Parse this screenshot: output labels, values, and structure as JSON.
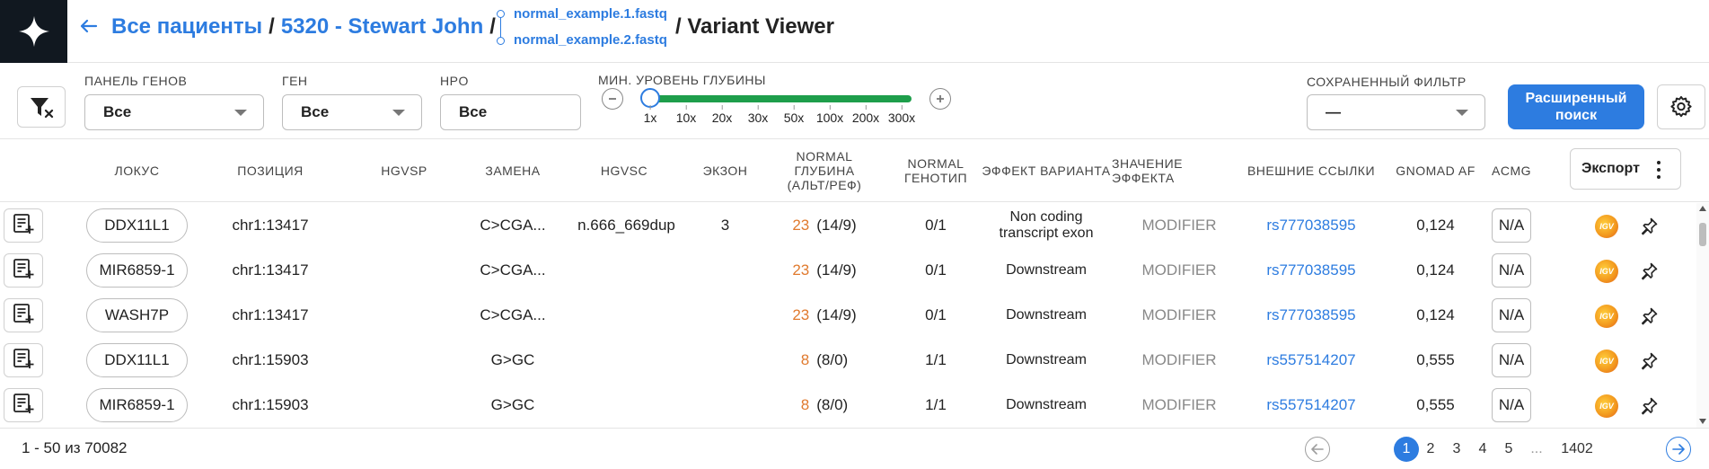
{
  "header": {
    "breadcrumb_all": "Все пациенты",
    "separator": "/",
    "breadcrumb_patient": "5320 - Stewart John",
    "file1": "normal_example.1.fastq",
    "file2": "normal_example.2.fastq",
    "page_title": "/ Variant Viewer"
  },
  "filters": {
    "gene_panel_label": "ПАНЕЛЬ ГЕНОВ",
    "gene_panel_value": "Все",
    "gene_label": "ГЕН",
    "gene_value": "Все",
    "hpo_label": "HPO",
    "hpo_value": "Все",
    "depth_label": "МИН. УРОВЕНЬ ГЛУБИНЫ",
    "depth_ticks": [
      "1x",
      "10x",
      "20x",
      "30x",
      "50x",
      "100x",
      "200x",
      "300x"
    ],
    "depth_selected": "1x",
    "saved_filter_label": "СОХРАНЕННЫЙ ФИЛЬТР",
    "saved_filter_value": "—",
    "advanced_search_line1": "Расширенный",
    "advanced_search_line2": "поиск"
  },
  "table": {
    "columns": {
      "locus": "ЛОКУС",
      "position": "ПОЗИЦИЯ",
      "hgvsp": "HGVSP",
      "substitution": "ЗАМЕНА",
      "hgvsc": "HGVSC",
      "exon": "ЭКЗОН",
      "normal_depth": "NORMAL ГЛУБИНА (АЛЬТ/РЕФ)",
      "normal_genotype": "NORMAL ГЕНОТИП",
      "variant_effect": "ЭФФЕКТ ВАРИАНТА",
      "effect_value": "ЗНАЧЕНИЕ ЭФФЕКТА",
      "external_links": "ВНЕШНИЕ ССЫЛКИ",
      "gnomad_af": "GNOMAD AF",
      "acmg": "ACMG"
    },
    "export_label": "Экспорт",
    "rows": [
      {
        "locus": "DDX11L1",
        "position": "chr1:13417",
        "hgvsp": "",
        "substitution": "C>CGA...",
        "hgvsc": "n.666_669dup",
        "exon": "3",
        "depth_n": "23",
        "depth_ratio": "(14/9)",
        "genotype": "0/1",
        "effect": "Non coding transcript exon",
        "impact": "MODIFIER",
        "rsid": "rs777038595",
        "gnomad": "0,124",
        "acmg": "N/A"
      },
      {
        "locus": "MIR6859-1",
        "position": "chr1:13417",
        "hgvsp": "",
        "substitution": "C>CGA...",
        "hgvsc": "",
        "exon": "",
        "depth_n": "23",
        "depth_ratio": "(14/9)",
        "genotype": "0/1",
        "effect": "Downstream",
        "impact": "MODIFIER",
        "rsid": "rs777038595",
        "gnomad": "0,124",
        "acmg": "N/A"
      },
      {
        "locus": "WASH7P",
        "position": "chr1:13417",
        "hgvsp": "",
        "substitution": "C>CGA...",
        "hgvsc": "",
        "exon": "",
        "depth_n": "23",
        "depth_ratio": "(14/9)",
        "genotype": "0/1",
        "effect": "Downstream",
        "impact": "MODIFIER",
        "rsid": "rs777038595",
        "gnomad": "0,124",
        "acmg": "N/A"
      },
      {
        "locus": "DDX11L1",
        "position": "chr1:15903",
        "hgvsp": "",
        "substitution": "G>GC",
        "hgvsc": "",
        "exon": "",
        "depth_n": "8",
        "depth_ratio": "(8/0)",
        "genotype": "1/1",
        "effect": "Downstream",
        "impact": "MODIFIER",
        "rsid": "rs557514207",
        "gnomad": "0,555",
        "acmg": "N/A"
      },
      {
        "locus": "MIR6859-1",
        "position": "chr1:15903",
        "hgvsp": "",
        "substitution": "G>GC",
        "hgvsc": "",
        "exon": "",
        "depth_n": "8",
        "depth_ratio": "(8/0)",
        "genotype": "1/1",
        "effect": "Downstream",
        "impact": "MODIFIER",
        "rsid": "rs557514207",
        "gnomad": "0,555",
        "acmg": "N/A"
      }
    ]
  },
  "footer": {
    "count": "1 - 50 из 70082",
    "pages": [
      "1",
      "2",
      "3",
      "4",
      "5",
      "...",
      "1402"
    ],
    "active_page": "1"
  },
  "icons": {
    "logo": "sparkle-star-logo",
    "back": "arrow-left-icon",
    "filter_reset": "filter-clear-icon",
    "zoom_out": "minus-circle-icon",
    "zoom_in": "plus-circle-icon",
    "settings": "gear-icon",
    "row_action": "note-add-icon",
    "igv": "igv-icon",
    "pin": "pin-icon",
    "export_menu": "kebab-icon"
  },
  "colors": {
    "accent": "#2d7ce0",
    "logo_bg": "#111820",
    "slider": "#1e9e4b",
    "depth_number": "#e07a2e",
    "impact_text": "#888888"
  }
}
